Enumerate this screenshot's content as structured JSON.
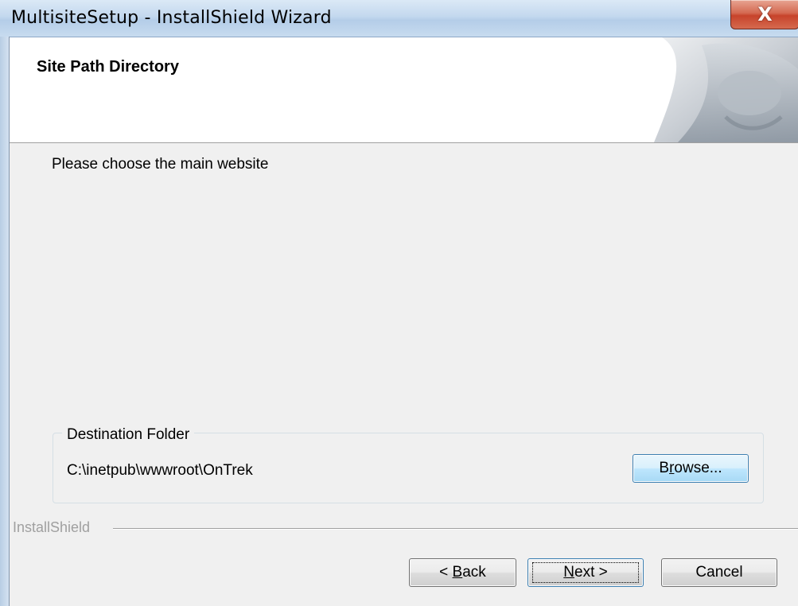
{
  "window": {
    "title": "MultisiteSetup - InstallShield Wizard",
    "close_label": "X"
  },
  "header": {
    "title": "Site Path Directory"
  },
  "body": {
    "subtitle": "Please choose the main website"
  },
  "destination": {
    "group_label": "Destination Folder",
    "path": "C:\\inetpub\\wwwroot\\OnTrek",
    "browse_label_pre": "B",
    "browse_label_accel": "r",
    "browse_label_post": "owse..."
  },
  "footer": {
    "brand": "InstallShield",
    "back_prefix": "< ",
    "back_accel": "B",
    "back_rest": "ack",
    "next_accel": "N",
    "next_rest": "ext >",
    "cancel_label": "Cancel"
  },
  "colors": {
    "close_button": "#c7432b",
    "dialog_background": "#f0f0f0",
    "header_background": "#ffffff"
  }
}
